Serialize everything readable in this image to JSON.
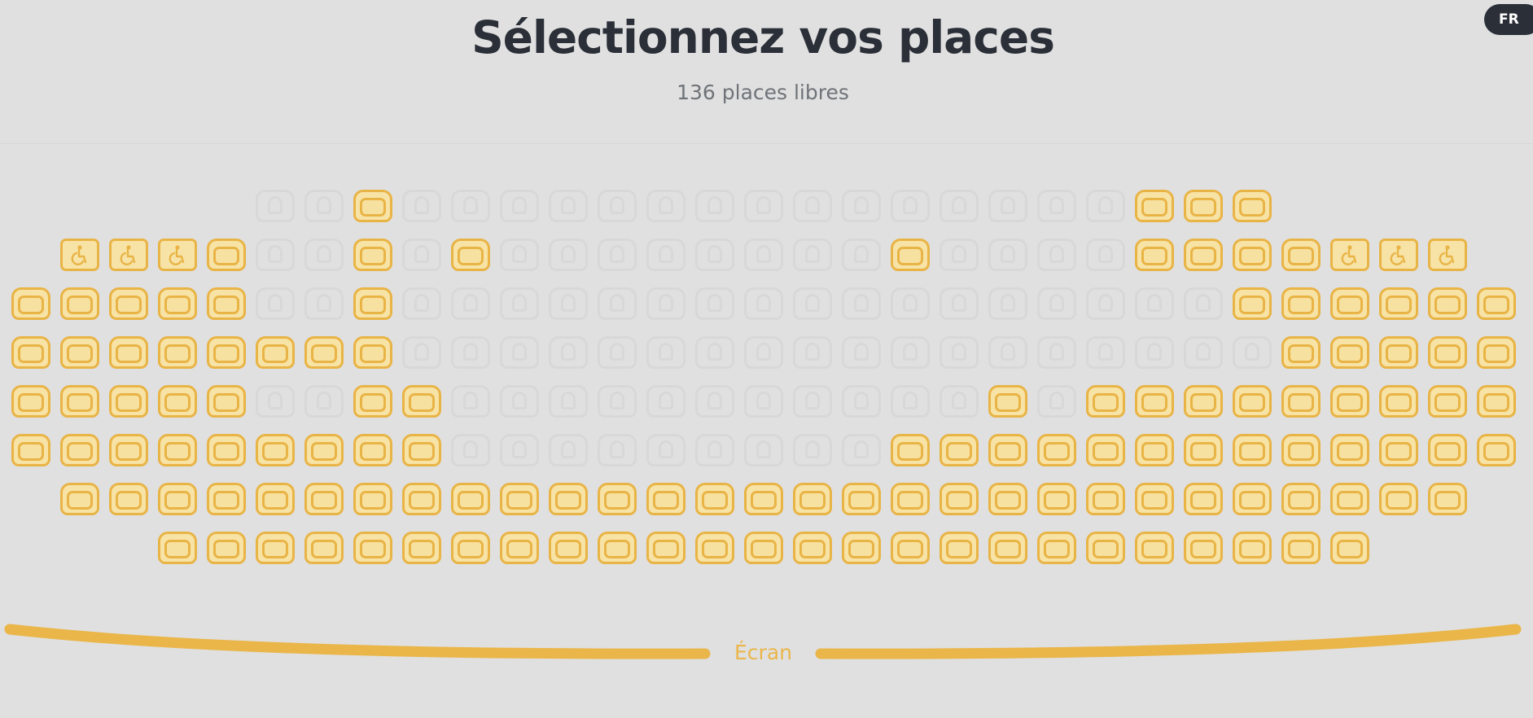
{
  "language": {
    "label": "FR"
  },
  "header": {
    "title": "Sélectionnez vos places",
    "subtitle": "136 places libres"
  },
  "seat_map": {
    "legend_colors": {
      "free": "#f7e3a6",
      "free_border": "#e9b446",
      "taken_border": "#d8d8d8"
    },
    "rows": [
      {
        "first_col": 5,
        "seats": "TTFTTTTTTTTTTTTTTTFFF"
      },
      {
        "first_col": 1,
        "seats": "WWWFTTFTFTTTTTTTTFTTTTFFFFWWW"
      },
      {
        "first_col": 0,
        "seats": "FFFFFTTFTTTTTTTTTTTTTTTTTFFFFFF"
      },
      {
        "first_col": 0,
        "seats": "FFFFFFFFTTTTTTTTTTTTTTTTTTFFFFF"
      },
      {
        "first_col": 0,
        "seats": "FFFFFTTFFTTTTTTTTTTTFTFFFFFFFFF"
      },
      {
        "first_col": 0,
        "seats": "FFFFFFFFFTTTTTTTTTFFFFFFFFFFFFF"
      },
      {
        "first_col": 1,
        "seats": "FFFFFFFFFFFFFFFFFFFFFFFFFFFFF"
      },
      {
        "first_col": 3,
        "seats": "FFFFFFFFFFFFFFFFFFFFFFFFF"
      }
    ]
  },
  "screen": {
    "label": "Écran",
    "color": "#eab64a"
  }
}
